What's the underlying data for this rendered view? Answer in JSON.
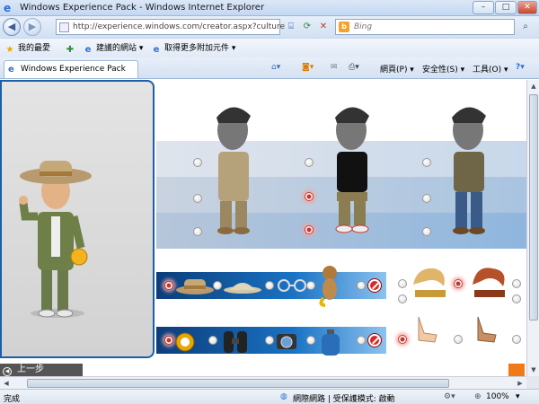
{
  "window": {
    "title": "Windows Experience Pack - Windows Internet Explorer",
    "min": "–",
    "max": "□",
    "close": "✕"
  },
  "nav": {
    "back": "◀",
    "forward": "▶",
    "url": "http://experience.windows.com/creator.aspx?culture",
    "search_placeholder": "Bing"
  },
  "favorites": {
    "fav_label": "我的最愛",
    "suggested_label": "建議的網站 ▾",
    "addons_label": "取得更多附加元件 ▾"
  },
  "tab": {
    "label": "Windows Experience Pack"
  },
  "commandbar": {
    "page_label": "網頁(P) ▾",
    "safety_label": "安全性(S) ▾",
    "tools_label": "工具(O) ▾",
    "help_label": "?▾"
  },
  "content": {
    "prev_button": "上一步"
  },
  "status": {
    "left": "完成",
    "zone": "網際網路 | 受保護模式: 啟動",
    "zoom": "100%"
  },
  "colors": {
    "accent_blue": "#1b5fa8",
    "selected_red": "#c0392b",
    "orange": "#f07a17"
  },
  "icons": [
    "ie-logo-icon",
    "back-icon",
    "forward-icon",
    "compat-view-icon",
    "refresh-icon",
    "stop-icon",
    "bing-icon",
    "search-icon",
    "star-icon",
    "add-favorites-icon",
    "home-icon",
    "feeds-icon",
    "mail-icon",
    "print-icon",
    "globe-icon",
    "zoom-icon"
  ]
}
